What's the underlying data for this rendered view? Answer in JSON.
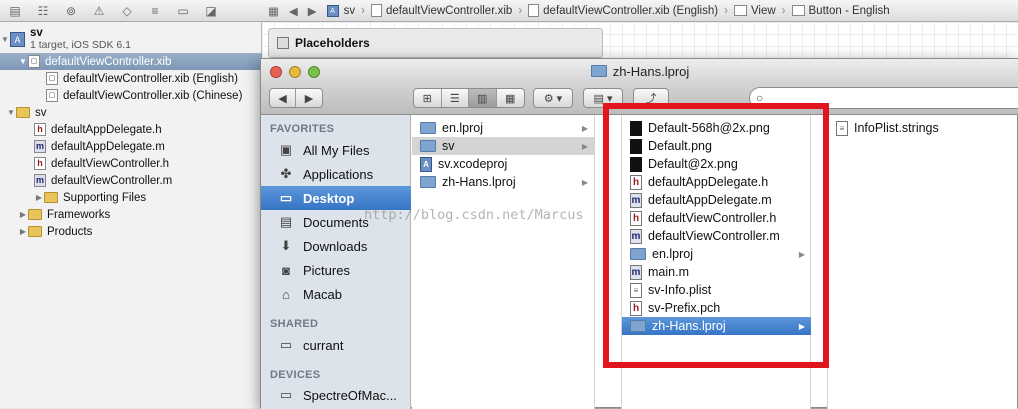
{
  "navigator": {
    "project": {
      "name": "sv",
      "subtitle": "1 target, iOS SDK 6.1"
    },
    "items": [
      {
        "label": "defaultViewController.xib",
        "kind": "xib",
        "selected": true
      },
      {
        "label": "defaultViewController.xib (English)",
        "kind": "xib"
      },
      {
        "label": "defaultViewController.xib (Chinese)",
        "kind": "xib"
      },
      {
        "label": "sv",
        "kind": "folder"
      },
      {
        "label": "defaultAppDelegate.h",
        "kind": "h"
      },
      {
        "label": "defaultAppDelegate.m",
        "kind": "m"
      },
      {
        "label": "defaultViewController.h",
        "kind": "h"
      },
      {
        "label": "defaultViewController.m",
        "kind": "m"
      },
      {
        "label": "Supporting Files",
        "kind": "folder"
      },
      {
        "label": "Frameworks",
        "kind": "folder"
      },
      {
        "label": "Products",
        "kind": "folder"
      }
    ]
  },
  "jumpbar": {
    "crumbs": [
      "sv",
      "defaultViewController.xib",
      "defaultViewController.xib (English)",
      "View",
      "Button - English"
    ]
  },
  "editor": {
    "placeholders_label": "Placeholders"
  },
  "finder": {
    "title": "zh-Hans.lproj",
    "sidebar": {
      "favorites_header": "FAVORITES",
      "favorites": [
        {
          "label": "All My Files",
          "icon": "all-files-icon"
        },
        {
          "label": "Applications",
          "icon": "applications-icon"
        },
        {
          "label": "Desktop",
          "icon": "desktop-icon",
          "selected": true
        },
        {
          "label": "Documents",
          "icon": "documents-icon"
        },
        {
          "label": "Downloads",
          "icon": "downloads-icon"
        },
        {
          "label": "Pictures",
          "icon": "pictures-icon"
        },
        {
          "label": "Macab",
          "icon": "home-icon"
        }
      ],
      "shared_header": "SHARED",
      "shared": [
        {
          "label": "currant",
          "icon": "computer-icon"
        }
      ],
      "devices_header": "DEVICES",
      "devices": [
        {
          "label": "SpectreOfMac...",
          "icon": "disk-icon"
        }
      ]
    },
    "column1": [
      {
        "label": "en.lproj",
        "kind": "folder",
        "arrow": true
      },
      {
        "label": "sv",
        "kind": "folder",
        "arrow": true,
        "highlighted": true
      },
      {
        "label": "sv.xcodeproj",
        "kind": "xcodeproj"
      },
      {
        "label": "zh-Hans.lproj",
        "kind": "folder",
        "arrow": true
      }
    ],
    "column2": [
      {
        "label": "Default-568h@2x.png",
        "kind": "png"
      },
      {
        "label": "Default.png",
        "kind": "png"
      },
      {
        "label": "Default@2x.png",
        "kind": "png"
      },
      {
        "label": "defaultAppDelegate.h",
        "kind": "h"
      },
      {
        "label": "defaultAppDelegate.m",
        "kind": "m"
      },
      {
        "label": "defaultViewController.h",
        "kind": "h"
      },
      {
        "label": "defaultViewController.m",
        "kind": "m"
      },
      {
        "label": "en.lproj",
        "kind": "folder",
        "arrow": true
      },
      {
        "label": "main.m",
        "kind": "m"
      },
      {
        "label": "sv-Info.plist",
        "kind": "plist"
      },
      {
        "label": "sv-Prefix.pch",
        "kind": "h"
      },
      {
        "label": "zh-Hans.lproj",
        "kind": "folder",
        "arrow": true,
        "selected": true
      }
    ],
    "column3": [
      {
        "label": "InfoPlist.strings",
        "kind": "strings"
      }
    ]
  },
  "watermark": "http://blog.csdn.net/Marcus",
  "colors": {
    "highlight_box": "#e0161c",
    "selection": "#3575c5"
  }
}
